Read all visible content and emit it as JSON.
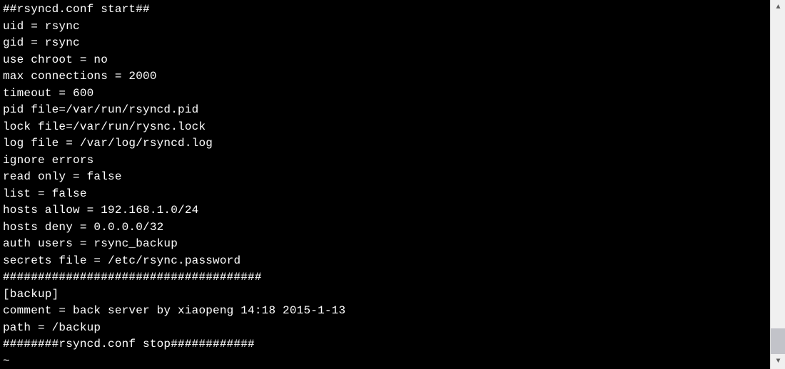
{
  "terminal": {
    "lines": [
      "##rsyncd.conf start##",
      "uid = rsync",
      "gid = rsync",
      "use chroot = no",
      "max connections = 2000",
      "timeout = 600",
      "pid file=/var/run/rsyncd.pid",
      "lock file=/var/run/rysnc.lock",
      "log file = /var/log/rsyncd.log",
      "ignore errors",
      "read only = false",
      "list = false",
      "hosts allow = 192.168.1.0/24",
      "hosts deny = 0.0.0.0/32",
      "auth users = rsync_backup",
      "secrets file = /etc/rsync.password",
      "#####################################",
      "[backup]",
      "comment = back server by xiaopeng 14:18 2015-1-13",
      "path = /backup",
      "########rsyncd.conf stop############",
      "~"
    ]
  },
  "scrollbar": {
    "arrow_up": "▲",
    "arrow_down": "▼"
  }
}
